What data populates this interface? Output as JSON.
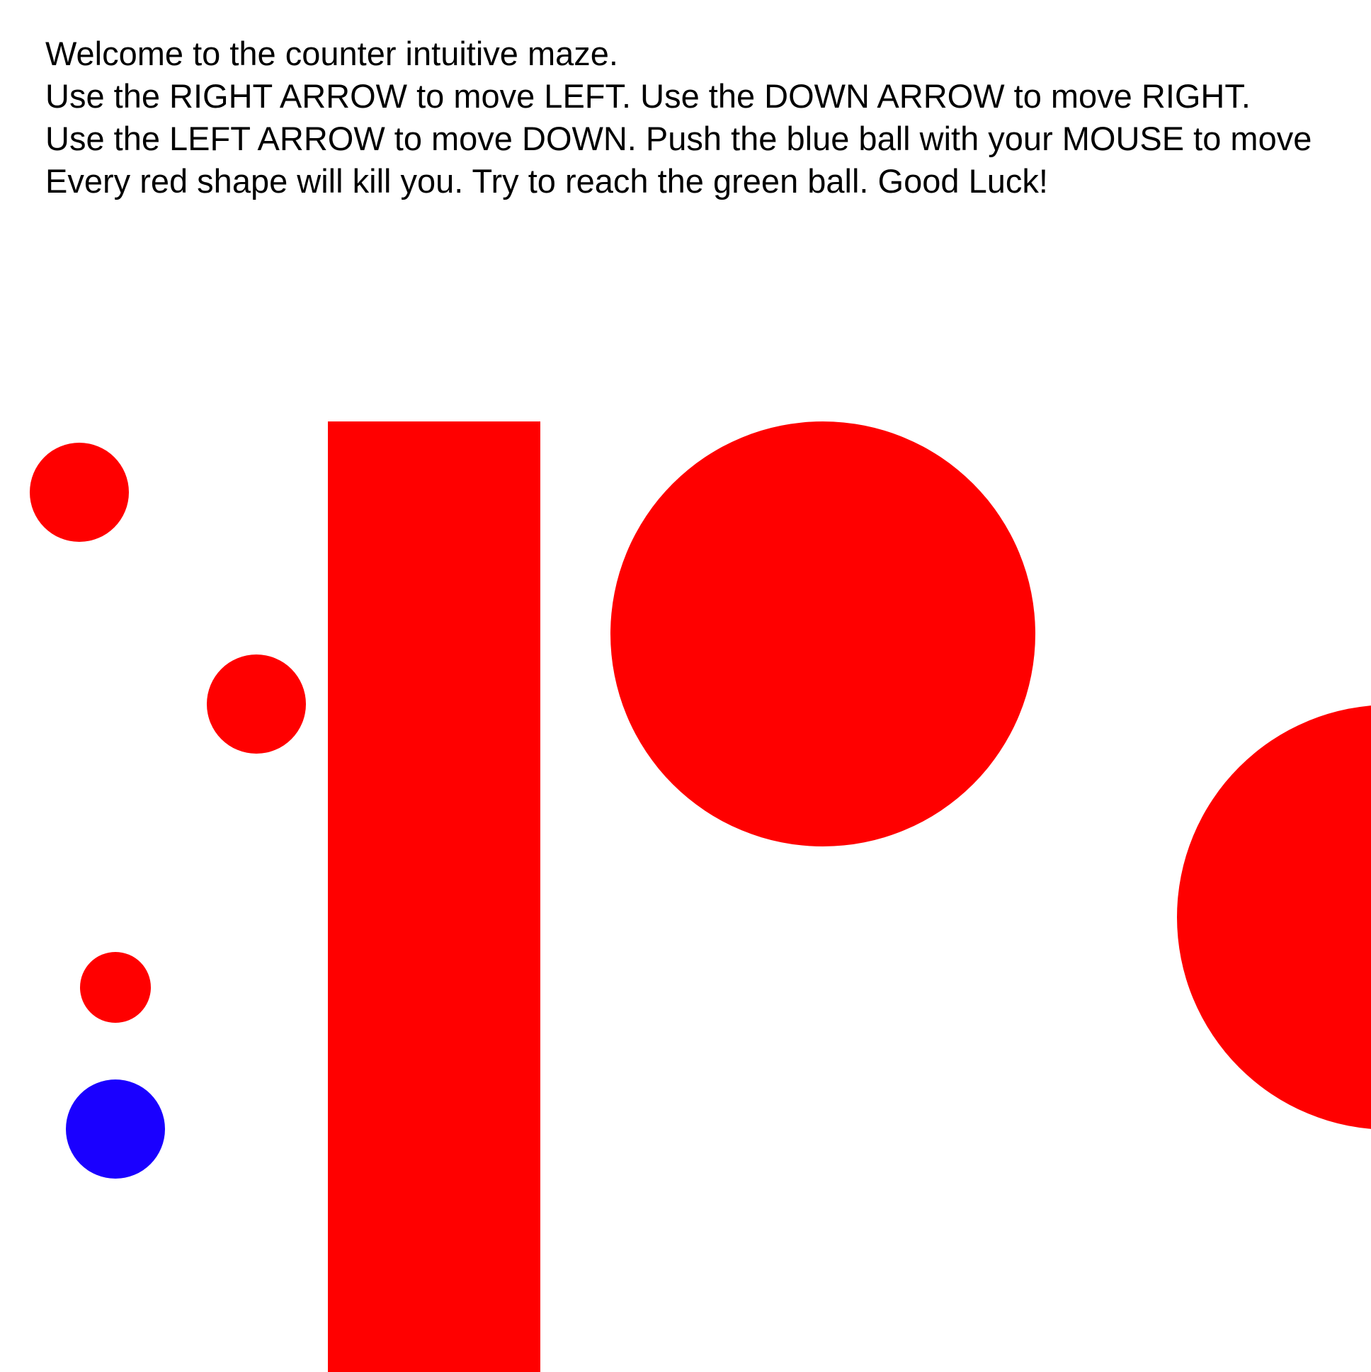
{
  "instructions": {
    "lines": [
      "Welcome to the counter intuitive maze.",
      "Use the RIGHT ARROW to move LEFT. Use the DOWN ARROW to move RIGHT.",
      "Use the LEFT ARROW to move DOWN. Push the blue ball with your MOUSE to move",
      "Every red shape will kill you. Try to reach the green ball. Good Luck!"
    ]
  },
  "colors": {
    "background": "#ffffff",
    "hazard": "#ff0000",
    "player": "#1a00ff",
    "text": "#000000"
  }
}
